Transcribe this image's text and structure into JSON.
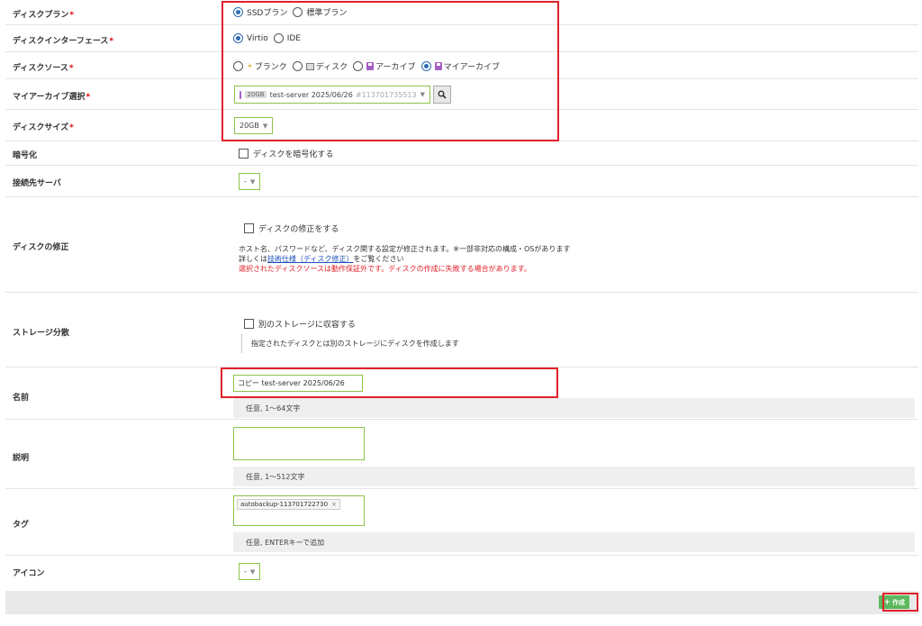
{
  "form": {
    "disk_plan": {
      "label": "ディスクプラン",
      "options": [
        "SSDプラン",
        "標準プラン"
      ],
      "selected": 0
    },
    "disk_interface": {
      "label": "ディスクインターフェース",
      "options": [
        "Virtio",
        "IDE"
      ],
      "selected": 0
    },
    "disk_source": {
      "label": "ディスクソース",
      "options": [
        "ブランク",
        "ディスク",
        "アーカイブ",
        "マイアーカイブ"
      ],
      "selected": 3
    },
    "my_archive": {
      "label": "マイアーカイブ選択",
      "size_badge": "20GB",
      "name": "test-server 2025/06/26",
      "id": "#113701735513"
    },
    "disk_size": {
      "label": "ディスクサイズ",
      "value": "20GB"
    },
    "encryption": {
      "label": "暗号化",
      "checkbox_label": "ディスクを暗号化する"
    },
    "connect_server": {
      "label": "接続先サーバ",
      "value": "-"
    },
    "disk_edit": {
      "label": "ディスクの修正",
      "checkbox_label": "ディスクの修正をする",
      "desc1": "ホスト名、パスワードなど、ディスク関する設定が修正されます。※一部非対応の構成・OSがあります",
      "desc2_prefix": "詳しくは",
      "desc2_link": "技術仕様（ディスク修正）",
      "desc2_suffix": "をご覧ください",
      "warning": "選択されたディスクソースは動作保証外です。ディスクの作成に失敗する場合があります。"
    },
    "storage": {
      "label": "ストレージ分散",
      "checkbox_label": "別のストレージに収容する",
      "note": "指定されたディスクとは別のストレージにディスクを作成します"
    },
    "name": {
      "label": "名前",
      "value": "コピー test-server 2025/06/26",
      "hint": "任意, 1～64文字"
    },
    "description": {
      "label": "説明",
      "value": "",
      "hint": "任意, 1～512文字"
    },
    "tags": {
      "label": "タグ",
      "items": [
        "autobackup-113701722730"
      ],
      "hint": "任意, ENTERキーで追加"
    },
    "icon": {
      "label": "アイコン",
      "value": "-"
    },
    "required_mark": "*",
    "create_button": "作成"
  },
  "colors": {
    "accent": "#5cb85c",
    "highlight": "#e0202a",
    "radio": "#2b6cb0",
    "purple": "#a45fc3"
  }
}
